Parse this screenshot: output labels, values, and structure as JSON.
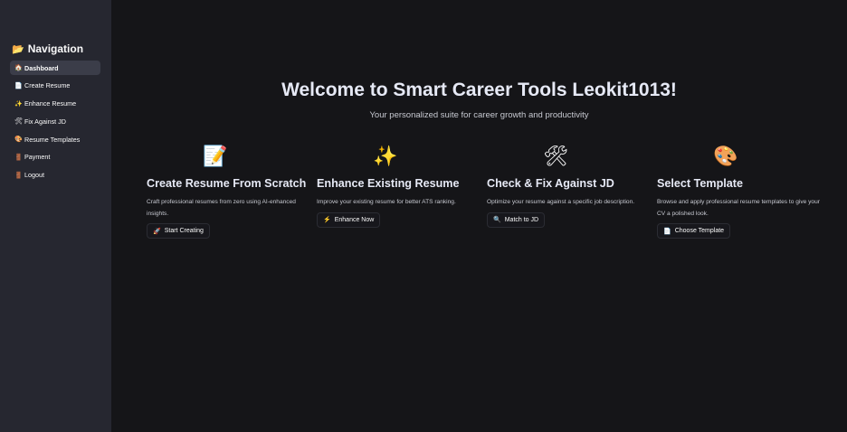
{
  "sidebar": {
    "title": "Navigation",
    "title_icon": "📂",
    "items": [
      {
        "icon": "🏠",
        "label": "Dashboard"
      },
      {
        "icon": "📄",
        "label": "Create Resume"
      },
      {
        "icon": "✨",
        "label": "Enhance Resume"
      },
      {
        "icon": "🛠",
        "label": "Fix Against JD"
      },
      {
        "icon": "🎨",
        "label": "Resume Templates"
      },
      {
        "icon": "🚪",
        "label": "Payment"
      },
      {
        "icon": "🚪",
        "label": "Logout"
      }
    ]
  },
  "hero": {
    "title": "Welcome to Smart Career Tools Leokit1013!",
    "subtitle": "Your personalized suite for career growth and productivity"
  },
  "cards": [
    {
      "icon": "📝",
      "title": "Create Resume From Scratch",
      "description": "Craft professional resumes from zero using AI-enhanced insights.",
      "button_icon": "🚀",
      "button_label": "Start Creating"
    },
    {
      "icon": "✨",
      "title": "Enhance Existing Resume",
      "description": "Improve your existing resume for better ATS ranking.",
      "button_icon": "⚡",
      "button_label": "Enhance Now"
    },
    {
      "icon": "🛠",
      "title": "Check & Fix Against JD",
      "description": "Optimize your resume against a specific job description.",
      "button_icon": "🔍",
      "button_label": "Match to JD"
    },
    {
      "icon": "🎨",
      "title": "Select Template",
      "description": "Browse and apply professional resume templates to give your CV a polished look.",
      "button_icon": "📄",
      "button_label": "Choose Template"
    }
  ],
  "colors": {
    "sidebar_bg": "#262730",
    "main_bg": "#151518",
    "active_item_bg": "#3b3d49",
    "text": "#fafafa"
  }
}
